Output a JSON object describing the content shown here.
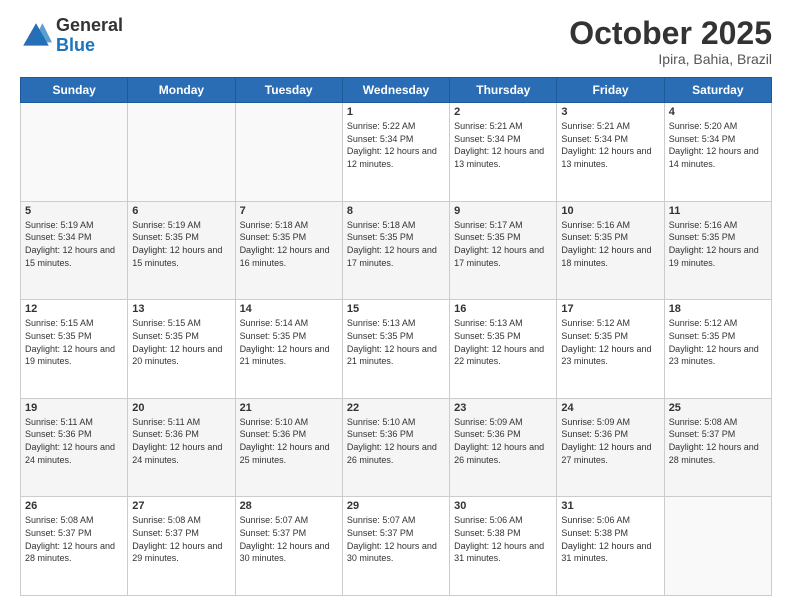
{
  "logo": {
    "general": "General",
    "blue": "Blue"
  },
  "header": {
    "month": "October 2025",
    "location": "Ipira, Bahia, Brazil"
  },
  "weekdays": [
    "Sunday",
    "Monday",
    "Tuesday",
    "Wednesday",
    "Thursday",
    "Friday",
    "Saturday"
  ],
  "weeks": [
    [
      {
        "day": "",
        "sunrise": "",
        "sunset": "",
        "daylight": ""
      },
      {
        "day": "",
        "sunrise": "",
        "sunset": "",
        "daylight": ""
      },
      {
        "day": "",
        "sunrise": "",
        "sunset": "",
        "daylight": ""
      },
      {
        "day": "1",
        "sunrise": "Sunrise: 5:22 AM",
        "sunset": "Sunset: 5:34 PM",
        "daylight": "Daylight: 12 hours and 12 minutes."
      },
      {
        "day": "2",
        "sunrise": "Sunrise: 5:21 AM",
        "sunset": "Sunset: 5:34 PM",
        "daylight": "Daylight: 12 hours and 13 minutes."
      },
      {
        "day": "3",
        "sunrise": "Sunrise: 5:21 AM",
        "sunset": "Sunset: 5:34 PM",
        "daylight": "Daylight: 12 hours and 13 minutes."
      },
      {
        "day": "4",
        "sunrise": "Sunrise: 5:20 AM",
        "sunset": "Sunset: 5:34 PM",
        "daylight": "Daylight: 12 hours and 14 minutes."
      }
    ],
    [
      {
        "day": "5",
        "sunrise": "Sunrise: 5:19 AM",
        "sunset": "Sunset: 5:34 PM",
        "daylight": "Daylight: 12 hours and 15 minutes."
      },
      {
        "day": "6",
        "sunrise": "Sunrise: 5:19 AM",
        "sunset": "Sunset: 5:35 PM",
        "daylight": "Daylight: 12 hours and 15 minutes."
      },
      {
        "day": "7",
        "sunrise": "Sunrise: 5:18 AM",
        "sunset": "Sunset: 5:35 PM",
        "daylight": "Daylight: 12 hours and 16 minutes."
      },
      {
        "day": "8",
        "sunrise": "Sunrise: 5:18 AM",
        "sunset": "Sunset: 5:35 PM",
        "daylight": "Daylight: 12 hours and 17 minutes."
      },
      {
        "day": "9",
        "sunrise": "Sunrise: 5:17 AM",
        "sunset": "Sunset: 5:35 PM",
        "daylight": "Daylight: 12 hours and 17 minutes."
      },
      {
        "day": "10",
        "sunrise": "Sunrise: 5:16 AM",
        "sunset": "Sunset: 5:35 PM",
        "daylight": "Daylight: 12 hours and 18 minutes."
      },
      {
        "day": "11",
        "sunrise": "Sunrise: 5:16 AM",
        "sunset": "Sunset: 5:35 PM",
        "daylight": "Daylight: 12 hours and 19 minutes."
      }
    ],
    [
      {
        "day": "12",
        "sunrise": "Sunrise: 5:15 AM",
        "sunset": "Sunset: 5:35 PM",
        "daylight": "Daylight: 12 hours and 19 minutes."
      },
      {
        "day": "13",
        "sunrise": "Sunrise: 5:15 AM",
        "sunset": "Sunset: 5:35 PM",
        "daylight": "Daylight: 12 hours and 20 minutes."
      },
      {
        "day": "14",
        "sunrise": "Sunrise: 5:14 AM",
        "sunset": "Sunset: 5:35 PM",
        "daylight": "Daylight: 12 hours and 21 minutes."
      },
      {
        "day": "15",
        "sunrise": "Sunrise: 5:13 AM",
        "sunset": "Sunset: 5:35 PM",
        "daylight": "Daylight: 12 hours and 21 minutes."
      },
      {
        "day": "16",
        "sunrise": "Sunrise: 5:13 AM",
        "sunset": "Sunset: 5:35 PM",
        "daylight": "Daylight: 12 hours and 22 minutes."
      },
      {
        "day": "17",
        "sunrise": "Sunrise: 5:12 AM",
        "sunset": "Sunset: 5:35 PM",
        "daylight": "Daylight: 12 hours and 23 minutes."
      },
      {
        "day": "18",
        "sunrise": "Sunrise: 5:12 AM",
        "sunset": "Sunset: 5:35 PM",
        "daylight": "Daylight: 12 hours and 23 minutes."
      }
    ],
    [
      {
        "day": "19",
        "sunrise": "Sunrise: 5:11 AM",
        "sunset": "Sunset: 5:36 PM",
        "daylight": "Daylight: 12 hours and 24 minutes."
      },
      {
        "day": "20",
        "sunrise": "Sunrise: 5:11 AM",
        "sunset": "Sunset: 5:36 PM",
        "daylight": "Daylight: 12 hours and 24 minutes."
      },
      {
        "day": "21",
        "sunrise": "Sunrise: 5:10 AM",
        "sunset": "Sunset: 5:36 PM",
        "daylight": "Daylight: 12 hours and 25 minutes."
      },
      {
        "day": "22",
        "sunrise": "Sunrise: 5:10 AM",
        "sunset": "Sunset: 5:36 PM",
        "daylight": "Daylight: 12 hours and 26 minutes."
      },
      {
        "day": "23",
        "sunrise": "Sunrise: 5:09 AM",
        "sunset": "Sunset: 5:36 PM",
        "daylight": "Daylight: 12 hours and 26 minutes."
      },
      {
        "day": "24",
        "sunrise": "Sunrise: 5:09 AM",
        "sunset": "Sunset: 5:36 PM",
        "daylight": "Daylight: 12 hours and 27 minutes."
      },
      {
        "day": "25",
        "sunrise": "Sunrise: 5:08 AM",
        "sunset": "Sunset: 5:37 PM",
        "daylight": "Daylight: 12 hours and 28 minutes."
      }
    ],
    [
      {
        "day": "26",
        "sunrise": "Sunrise: 5:08 AM",
        "sunset": "Sunset: 5:37 PM",
        "daylight": "Daylight: 12 hours and 28 minutes."
      },
      {
        "day": "27",
        "sunrise": "Sunrise: 5:08 AM",
        "sunset": "Sunset: 5:37 PM",
        "daylight": "Daylight: 12 hours and 29 minutes."
      },
      {
        "day": "28",
        "sunrise": "Sunrise: 5:07 AM",
        "sunset": "Sunset: 5:37 PM",
        "daylight": "Daylight: 12 hours and 30 minutes."
      },
      {
        "day": "29",
        "sunrise": "Sunrise: 5:07 AM",
        "sunset": "Sunset: 5:37 PM",
        "daylight": "Daylight: 12 hours and 30 minutes."
      },
      {
        "day": "30",
        "sunrise": "Sunrise: 5:06 AM",
        "sunset": "Sunset: 5:38 PM",
        "daylight": "Daylight: 12 hours and 31 minutes."
      },
      {
        "day": "31",
        "sunrise": "Sunrise: 5:06 AM",
        "sunset": "Sunset: 5:38 PM",
        "daylight": "Daylight: 12 hours and 31 minutes."
      },
      {
        "day": "",
        "sunrise": "",
        "sunset": "",
        "daylight": ""
      }
    ]
  ]
}
